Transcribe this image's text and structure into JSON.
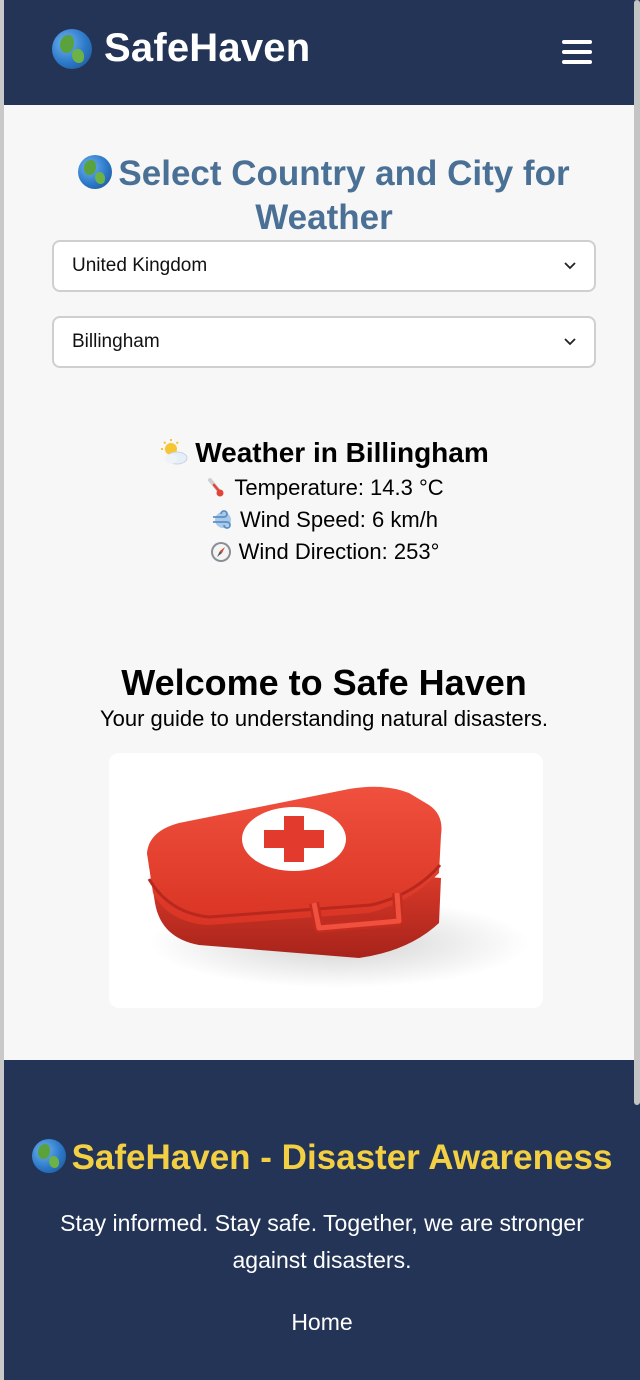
{
  "header": {
    "brand": "SafeHaven",
    "menu_icon": "hamburger-menu-icon"
  },
  "selector": {
    "title": "Select Country and City for Weather",
    "country": "United Kingdom",
    "city": "Billingham"
  },
  "weather": {
    "title": "Weather in Billingham",
    "temperature": "Temperature: 14.3 °C",
    "wind_speed": "Wind Speed: 6 km/h",
    "wind_direction": "Wind Direction: 253°"
  },
  "welcome": {
    "title": "Welcome to Safe Haven",
    "subtitle": "Your guide to understanding natural disasters."
  },
  "footer": {
    "title": "SafeHaven - Disaster Awareness",
    "tagline": "Stay informed. Stay safe. Together, we are stronger against disasters.",
    "link_home": "Home"
  },
  "colors": {
    "header_bg": "#233456",
    "title_blue": "#4a7195",
    "footer_title": "#f2cf43"
  }
}
